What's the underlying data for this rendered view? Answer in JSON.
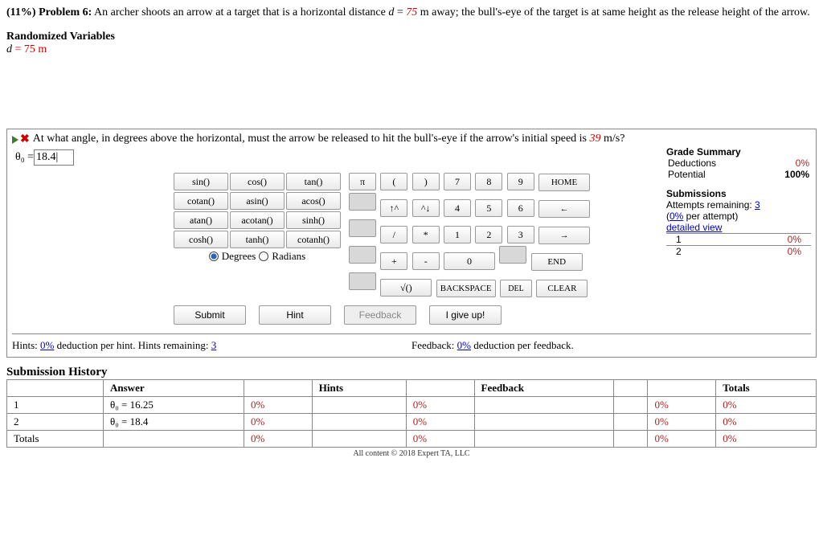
{
  "problem": {
    "percent": "(11%)",
    "label": "Problem 6:",
    "text1": "An archer shoots an arrow at a target that is a horizontal distance ",
    "d_var": "d",
    "d_val": "75",
    "text2": " m away; the bull's-eye of the target is at same height as the release height of the arrow."
  },
  "randomized": {
    "title": "Randomized Variables",
    "line_var": "d",
    "line_val": "= 75 m"
  },
  "part": {
    "question": "At what angle, in degrees above the horizontal, must the arrow be released to hit the bull's-eye if the arrow's initial speed is ",
    "speed": "39",
    "question_tail": " m/s?",
    "answer_label": "θ₀ = ",
    "answer_value": "18.4|"
  },
  "grade": {
    "title": "Grade Summary",
    "deductions_label": "Deductions",
    "deductions_val": "0%",
    "potential_label": "Potential",
    "potential_val": "100%",
    "subs_title": "Submissions",
    "attempts_prefix": "Attempts remaining: ",
    "attempts_n": "3",
    "per_attempt": "(0% per attempt)",
    "detailed": "detailed view",
    "r1a": "1",
    "r1b": "0%",
    "r2a": "2",
    "r2b": "0%"
  },
  "funcpad": {
    "r1": [
      "sin()",
      "cos()",
      "tan()"
    ],
    "r2": [
      "cotan()",
      "asin()",
      "acos()"
    ],
    "r3": [
      "atan()",
      "acotan()",
      "sinh()"
    ],
    "r4": [
      "cosh()",
      "tanh()",
      "cotanh()"
    ],
    "mode_deg": "Degrees",
    "mode_rad": "Radians"
  },
  "keypad": {
    "row1": [
      "π",
      "(",
      ")",
      "7",
      "8",
      "9",
      "HOME"
    ],
    "row2": [
      "",
      "↑^",
      "^↓",
      "4",
      "5",
      "6",
      "←"
    ],
    "row3": [
      "",
      "/",
      "*",
      "1",
      "2",
      "3",
      "→"
    ],
    "row4": [
      "",
      "+",
      "-",
      "0",
      "",
      "END"
    ],
    "row5": [
      "",
      "√()",
      "BACKSPACE",
      "DEL",
      "CLEAR"
    ]
  },
  "actions": {
    "submit": "Submit",
    "hint": "Hint",
    "feedback": "Feedback",
    "giveup": "I give up!"
  },
  "hints": {
    "prefix": "Hints: ",
    "ded": "0%",
    "mid": " deduction per hint. Hints remaining: ",
    "remain": "3"
  },
  "feedback": {
    "prefix": "Feedback: ",
    "ded": "0%",
    "tail": " deduction per feedback."
  },
  "history": {
    "title": "Submission History",
    "cols": [
      "",
      "Answer",
      "",
      "Hints",
      "",
      "Feedback",
      "",
      "",
      "Totals"
    ],
    "rows": [
      {
        "n": "1",
        "answer": "θ₀ = 16.25",
        "c3": "0%",
        "c5": "0%",
        "c7": "0%",
        "c8": "0%"
      },
      {
        "n": "2",
        "answer": "θ₀ = 18.4",
        "c3": "0%",
        "c5": "0%",
        "c7": "0%",
        "c8": "0%"
      }
    ],
    "totals": {
      "label": "Totals",
      "c3": "0%",
      "c5": "0%",
      "c7": "0%",
      "c8": "0%"
    }
  },
  "footer": "All content © 2018 Expert TA, LLC"
}
